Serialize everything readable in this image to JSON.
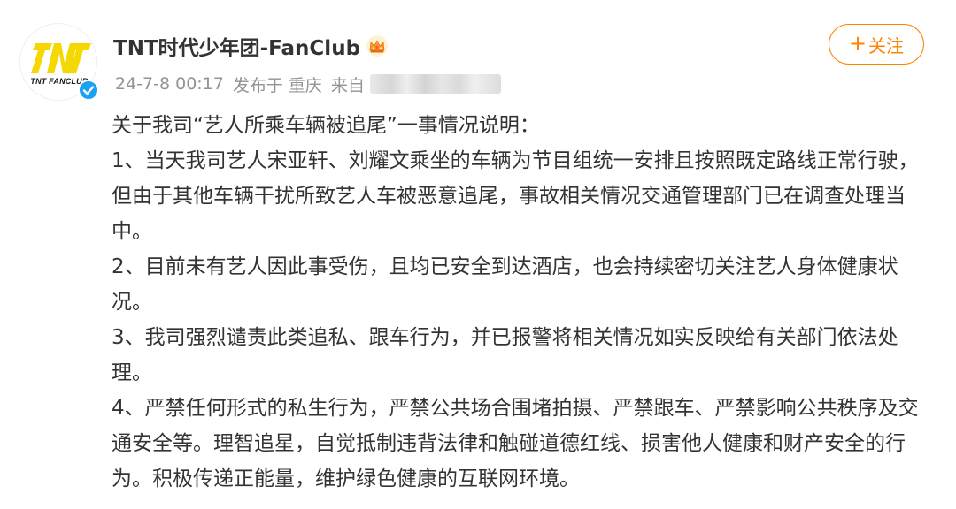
{
  "account": {
    "name": "TNT时代少年团-FanClub",
    "logo_text": "TNT FANCLUB",
    "avatar_icon": "tnt-logo-icon",
    "verified_icon": "verified-badge-icon",
    "vip_icon": "crown-icon"
  },
  "meta": {
    "datetime": "24-7-8 00:17",
    "location": "发布于 重庆",
    "source_label": "来自"
  },
  "follow_button": {
    "label": "关注",
    "icon": "plus-icon"
  },
  "post": {
    "paragraphs": [
      "关于我司“艺人所乘车辆被追尾”一事情况说明：",
      "1、当天我司艺人宋亚轩、刘耀文乘坐的车辆为节目组统一安排且按照既定路线正常行驶，但由于其他车辆干扰所致艺人车被恶意追尾，事故相关情况交通管理部门已在调查处理当中。",
      "2、目前未有艺人因此事受伤，且均已安全到达酒店，也会持续密切关注艺人身体健康状况。",
      "3、我司强烈谴责此类追私、跟车行为，并已报警将相关情况如实反映给有关部门依法处理。",
      "4、严禁任何形式的私生行为，严禁公共场合围堵拍摄、严禁跟车、严禁影响公共秩序及交通安全等。理智追星，自觉抵制违背法律和触碰道德红线、损害他人健康和财产安全的行为。积极传递正能量，维护绿色健康的互联网环境。"
    ]
  },
  "colors": {
    "accent": "#ff8200",
    "text": "#333333",
    "meta_text": "#939393",
    "verified": "#1da1f2",
    "logo_yellow": "#f5d800"
  }
}
